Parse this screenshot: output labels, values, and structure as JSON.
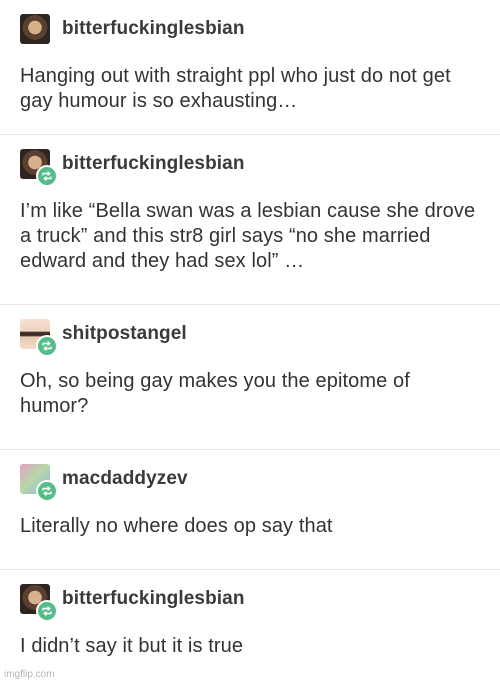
{
  "posts": [
    {
      "username": "bitterfuckinglesbian",
      "avatar_icon": "avatar-bitterfuckinglesbian",
      "reblog": false,
      "text": "Hanging out with straight ppl who just do not get gay humour is so exhausting…"
    },
    {
      "username": "bitterfuckinglesbian",
      "avatar_icon": "avatar-bitterfuckinglesbian",
      "reblog": true,
      "text": "I’m like “Bella swan was a lesbian cause she drove a truck” and this str8 girl says “no she married edward and they had sex lol” …"
    },
    {
      "username": "shitpostangel",
      "avatar_icon": "avatar-shitpostangel",
      "reblog": true,
      "text": "Oh, so being gay makes you the epitome of humor?"
    },
    {
      "username": "macdaddyzev",
      "avatar_icon": "avatar-macdaddyzev",
      "reblog": true,
      "text": "Literally no where does op say that"
    },
    {
      "username": "bitterfuckinglesbian",
      "avatar_icon": "avatar-bitterfuckinglesbian",
      "reblog": true,
      "text": "I didn’t say it but it is true"
    }
  ],
  "colors": {
    "reblog_badge": "#56bc8a",
    "divider": "#e6e6e6",
    "text": "#333333"
  },
  "watermark": "imgflip.com"
}
